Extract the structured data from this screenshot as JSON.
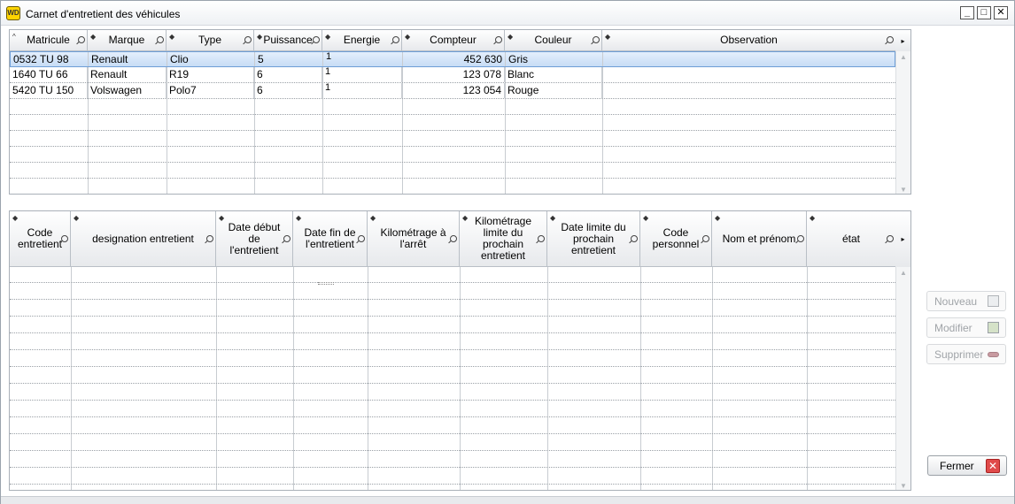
{
  "window": {
    "title": "Carnet d'entretient des véhicules",
    "icon_text": "WD",
    "minimize": "_",
    "maximize": "□",
    "close": "✕"
  },
  "vehicles": {
    "columns": [
      "Matricule",
      "Marque",
      "Type",
      "Puissance",
      "Energie",
      "Compteur",
      "Couleur",
      "Observation"
    ],
    "rows": [
      {
        "matricule": "0532 TU 98",
        "marque": "Renault",
        "type": "Clio",
        "puissance": "5",
        "energie": "1",
        "compteur": "452 630",
        "couleur": "Gris",
        "observation": ""
      },
      {
        "matricule": "1640 TU 66",
        "marque": "Renault",
        "type": "R19",
        "puissance": "6",
        "energie": "1",
        "compteur": "123 078",
        "couleur": "Blanc",
        "observation": ""
      },
      {
        "matricule": "5420 TU 150",
        "marque": "Volswagen",
        "type": "Polo7",
        "puissance": "6",
        "energie": "1",
        "compteur": "123 054",
        "couleur": "Rouge",
        "observation": ""
      }
    ],
    "selected_index": 0
  },
  "maintenance": {
    "columns": [
      "Code entretient",
      "designation entretient",
      "Date début de l'entretient",
      "Date fin de l'entretient",
      "Kilométrage à l'arrêt",
      "Kilométrage limite du prochain entretient",
      "Date limite du prochain entretient",
      "Code personnel",
      "Nom et prénom",
      "état"
    ],
    "rows": []
  },
  "buttons": {
    "nouveau": "Nouveau",
    "modifier": "Modifier",
    "supprimer": "Supprimer",
    "fermer": "Fermer"
  },
  "icons": {
    "sort": "triangle-up-icon",
    "filter": "magnifier-icon",
    "scroll_right": "arrow-right-icon",
    "scroll_up": "arrow-up-icon",
    "scroll_down": "arrow-down-icon"
  }
}
